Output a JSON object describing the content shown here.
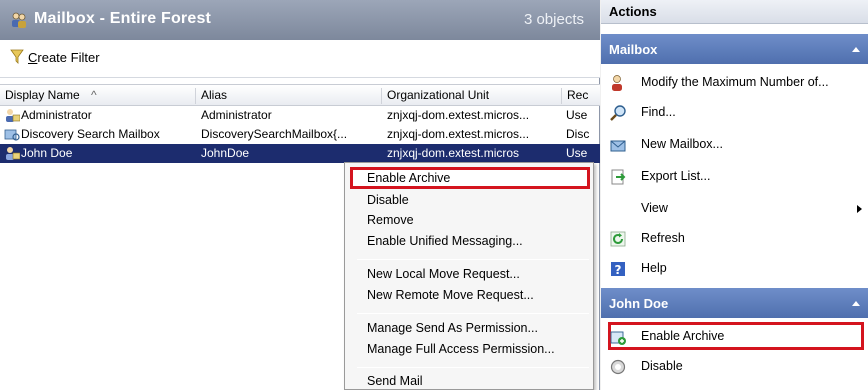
{
  "window": {
    "title": "Mailbox - Entire Forest",
    "object_count": "3 objects"
  },
  "toolbar": {
    "create_filter_prefix": "C",
    "create_filter_rest": "reate Filter"
  },
  "grid": {
    "columns": [
      "Display Name",
      "Alias",
      "Organizational Unit",
      "Rec"
    ],
    "sort_indicator": "^",
    "rows": [
      {
        "display_name": "Administrator",
        "alias": "Administrator",
        "ou": "znjxqj-dom.extest.micros...",
        "rec": "Use",
        "selected": false
      },
      {
        "display_name": "Discovery Search Mailbox",
        "alias": "DiscoverySearchMailbox{...",
        "ou": "znjxqj-dom.extest.micros...",
        "rec": "Disc",
        "selected": false
      },
      {
        "display_name": "John Doe",
        "alias": "JohnDoe",
        "ou": "znjxqj-dom.extest.micros",
        "rec": "Use",
        "selected": true
      }
    ]
  },
  "context_menu": {
    "items": [
      "Enable Archive",
      "Disable",
      "Remove",
      "Enable Unified Messaging...",
      "New Local Move Request...",
      "New Remote Move Request...",
      "Manage Send As Permission...",
      "Manage Full Access Permission...",
      "Send Mail"
    ]
  },
  "actions": {
    "title": "Actions",
    "mailbox_section": "Mailbox",
    "mailbox_items": [
      {
        "label": "Modify the Maximum Number of...",
        "icon": "user-settings-icon"
      },
      {
        "label": "Find...",
        "icon": "find-icon"
      },
      {
        "label": "New Mailbox...",
        "icon": "new-mailbox-icon"
      },
      {
        "label": "Export List...",
        "icon": "export-icon"
      },
      {
        "label": "View",
        "icon": "none"
      },
      {
        "label": "Refresh",
        "icon": "refresh-icon"
      },
      {
        "label": "Help",
        "icon": "help-icon"
      }
    ],
    "user_section": "John Doe",
    "user_items": [
      {
        "label": "Enable Archive",
        "icon": "enable-archive-icon"
      },
      {
        "label": "Disable",
        "icon": "disable-icon"
      }
    ]
  },
  "colors": {
    "selection": "#1c2c6e",
    "section_bar": "#5a79b8",
    "highlight_border": "#d4141e"
  }
}
